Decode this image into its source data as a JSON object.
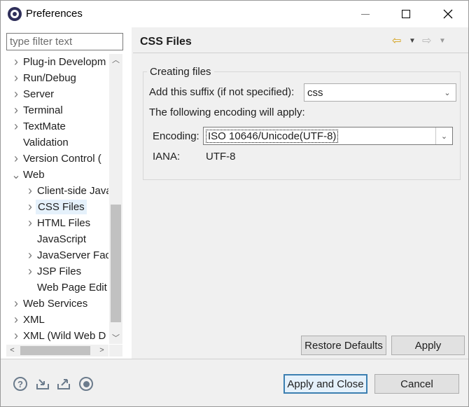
{
  "window": {
    "title": "Preferences"
  },
  "sidebar": {
    "filter_placeholder": "type filter text",
    "items": [
      {
        "label": "Plug-in Developm",
        "level": 0,
        "expander": "collapsed"
      },
      {
        "label": "Run/Debug",
        "level": 0,
        "expander": "collapsed"
      },
      {
        "label": "Server",
        "level": 0,
        "expander": "collapsed"
      },
      {
        "label": "Terminal",
        "level": 0,
        "expander": "collapsed"
      },
      {
        "label": "TextMate",
        "level": 0,
        "expander": "collapsed"
      },
      {
        "label": "Validation",
        "level": 0,
        "expander": "none"
      },
      {
        "label": "Version Control (",
        "level": 0,
        "expander": "collapsed"
      },
      {
        "label": "Web",
        "level": 0,
        "expander": "expanded"
      },
      {
        "label": "Client-side Java",
        "level": 1,
        "expander": "collapsed"
      },
      {
        "label": "CSS Files",
        "level": 1,
        "expander": "collapsed",
        "selected": true
      },
      {
        "label": "HTML Files",
        "level": 1,
        "expander": "collapsed"
      },
      {
        "label": "JavaScript",
        "level": 1,
        "expander": "none"
      },
      {
        "label": "JavaServer Face",
        "level": 1,
        "expander": "collapsed"
      },
      {
        "label": "JSP Files",
        "level": 1,
        "expander": "collapsed"
      },
      {
        "label": "Web Page Edit",
        "level": 1,
        "expander": "none"
      },
      {
        "label": "Web Services",
        "level": 0,
        "expander": "collapsed"
      },
      {
        "label": "XML",
        "level": 0,
        "expander": "collapsed"
      },
      {
        "label": "XML (Wild Web D",
        "level": 0,
        "expander": "collapsed"
      }
    ]
  },
  "page": {
    "title": "CSS Files",
    "group_title": "Creating files",
    "suffix_label": "Add this suffix (if not specified):",
    "suffix_value": "css",
    "encoding_note": "The following encoding will apply:",
    "encoding_label": "Encoding:",
    "encoding_value": "ISO 10646/Unicode(UTF-8)",
    "iana_label": "IANA:",
    "iana_value": "UTF-8"
  },
  "buttons": {
    "restore_defaults": "Restore Defaults",
    "apply": "Apply",
    "apply_and_close": "Apply and Close",
    "cancel": "Cancel"
  },
  "icons": {
    "help": "help-icon",
    "import": "import-icon",
    "export": "export-icon",
    "record": "record-icon",
    "nav_back": "back-arrow-icon",
    "nav_forward": "forward-arrow-icon"
  },
  "colors": {
    "selection": "#e5f1fb",
    "default_button_border": "#3c7fb1",
    "back_arrow": "#d4a017"
  }
}
